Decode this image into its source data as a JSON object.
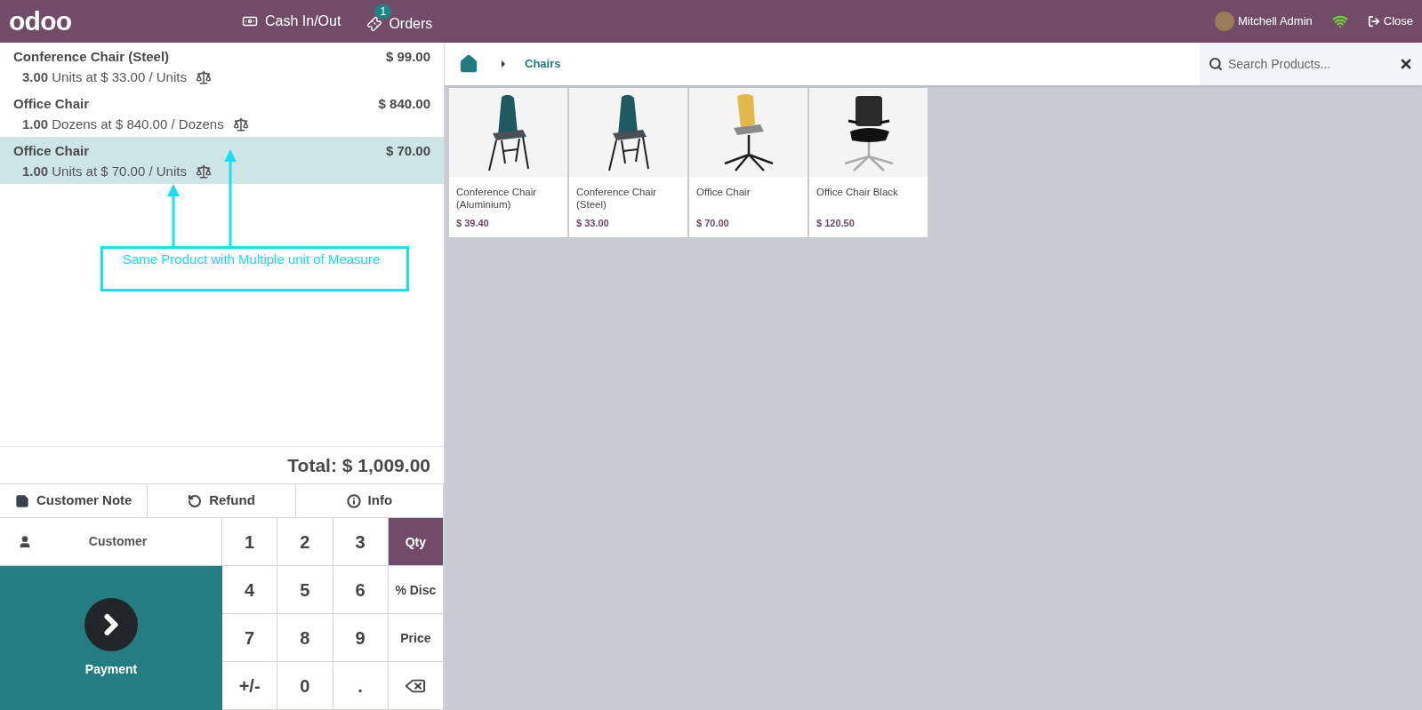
{
  "header": {
    "logo": "odoo",
    "cash": "Cash In/Out",
    "orders": {
      "label": "Orders",
      "badge": "1"
    },
    "user": "Mitchell Admin",
    "close": "Close"
  },
  "order_lines": [
    {
      "name": "Conference Chair (Steel)",
      "price": "$ 99.00",
      "qty": "3.00",
      "detail": "Units at $ 33.00 / Units",
      "selected": false
    },
    {
      "name": "Office Chair",
      "price": "$ 840.00",
      "qty": "1.00",
      "detail": "Dozens at $ 840.00 / Dozens",
      "selected": false
    },
    {
      "name": "Office Chair",
      "price": "$ 70.00",
      "qty": "1.00",
      "detail": "Units at $ 70.00 / Units",
      "selected": true
    }
  ],
  "annotation": {
    "text": "Same Product with Multiple unit of Measure"
  },
  "total": "Total: $ 1,009.00",
  "actions": [
    {
      "label": "Customer Note",
      "kind": "note"
    },
    {
      "label": "Refund",
      "kind": "refund"
    },
    {
      "label": "Info",
      "kind": "info"
    }
  ],
  "customer": "Customer",
  "payment": "Payment",
  "numpad": [
    {
      "label": "1",
      "kind": "digit"
    },
    {
      "label": "2",
      "kind": "digit"
    },
    {
      "label": "3",
      "kind": "digit"
    },
    {
      "label": "Qty",
      "kind": "mode",
      "selected": true
    },
    {
      "label": "4",
      "kind": "digit"
    },
    {
      "label": "5",
      "kind": "digit"
    },
    {
      "label": "6",
      "kind": "digit"
    },
    {
      "label": "% Disc",
      "kind": "mode",
      "selected": false
    },
    {
      "label": "7",
      "kind": "digit"
    },
    {
      "label": "8",
      "kind": "digit"
    },
    {
      "label": "9",
      "kind": "digit"
    },
    {
      "label": "Price",
      "kind": "mode",
      "selected": false
    },
    {
      "label": "+/-",
      "kind": "digit"
    },
    {
      "label": "0",
      "kind": "digit"
    },
    {
      "label": ".",
      "kind": "digit"
    },
    {
      "kind": "backspace"
    }
  ],
  "breadcrumb": {
    "category": "Chairs"
  },
  "search": {
    "placeholder": "Search Products..."
  },
  "products": [
    {
      "name": "Conference Chair (Aluminium)",
      "price": "$ 39.40",
      "kind": "shell"
    },
    {
      "name": "Conference Chair (Steel)",
      "price": "$ 33.00",
      "kind": "shell"
    },
    {
      "name": "Office Chair",
      "price": "$ 70.00",
      "kind": "swivel"
    },
    {
      "name": "Office Chair Black",
      "price": "$ 120.50",
      "kind": "mesh"
    }
  ]
}
